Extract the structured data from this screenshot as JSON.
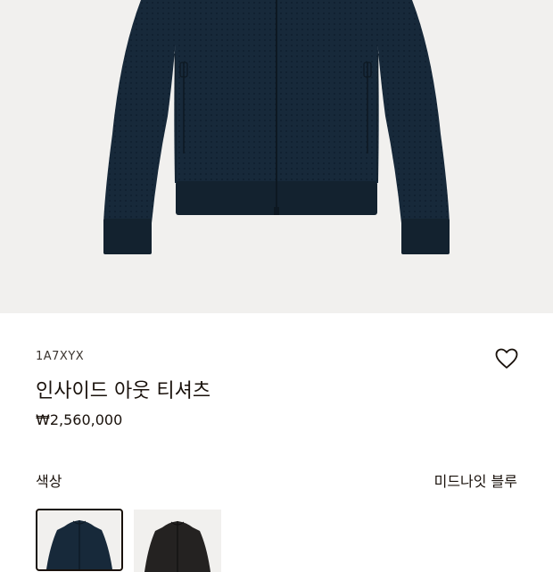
{
  "product": {
    "sku": "1A7XYX",
    "name": "인사이드 아웃 티셔츠",
    "price": "₩2,560,000"
  },
  "color": {
    "label": "색상",
    "selected_value": "미드나잇 블루"
  },
  "swatches": [
    {
      "color_name": "midnight-blue",
      "color": "#17293a",
      "selected": true
    },
    {
      "color_name": "black",
      "color": "#242221",
      "selected": false
    }
  ],
  "icons": {
    "wishlist": "heart-outline-icon"
  },
  "colors": {
    "background": "#ffffff",
    "image_background": "#f1f0ee",
    "jacket": "#17293a",
    "text": "#19110b"
  }
}
